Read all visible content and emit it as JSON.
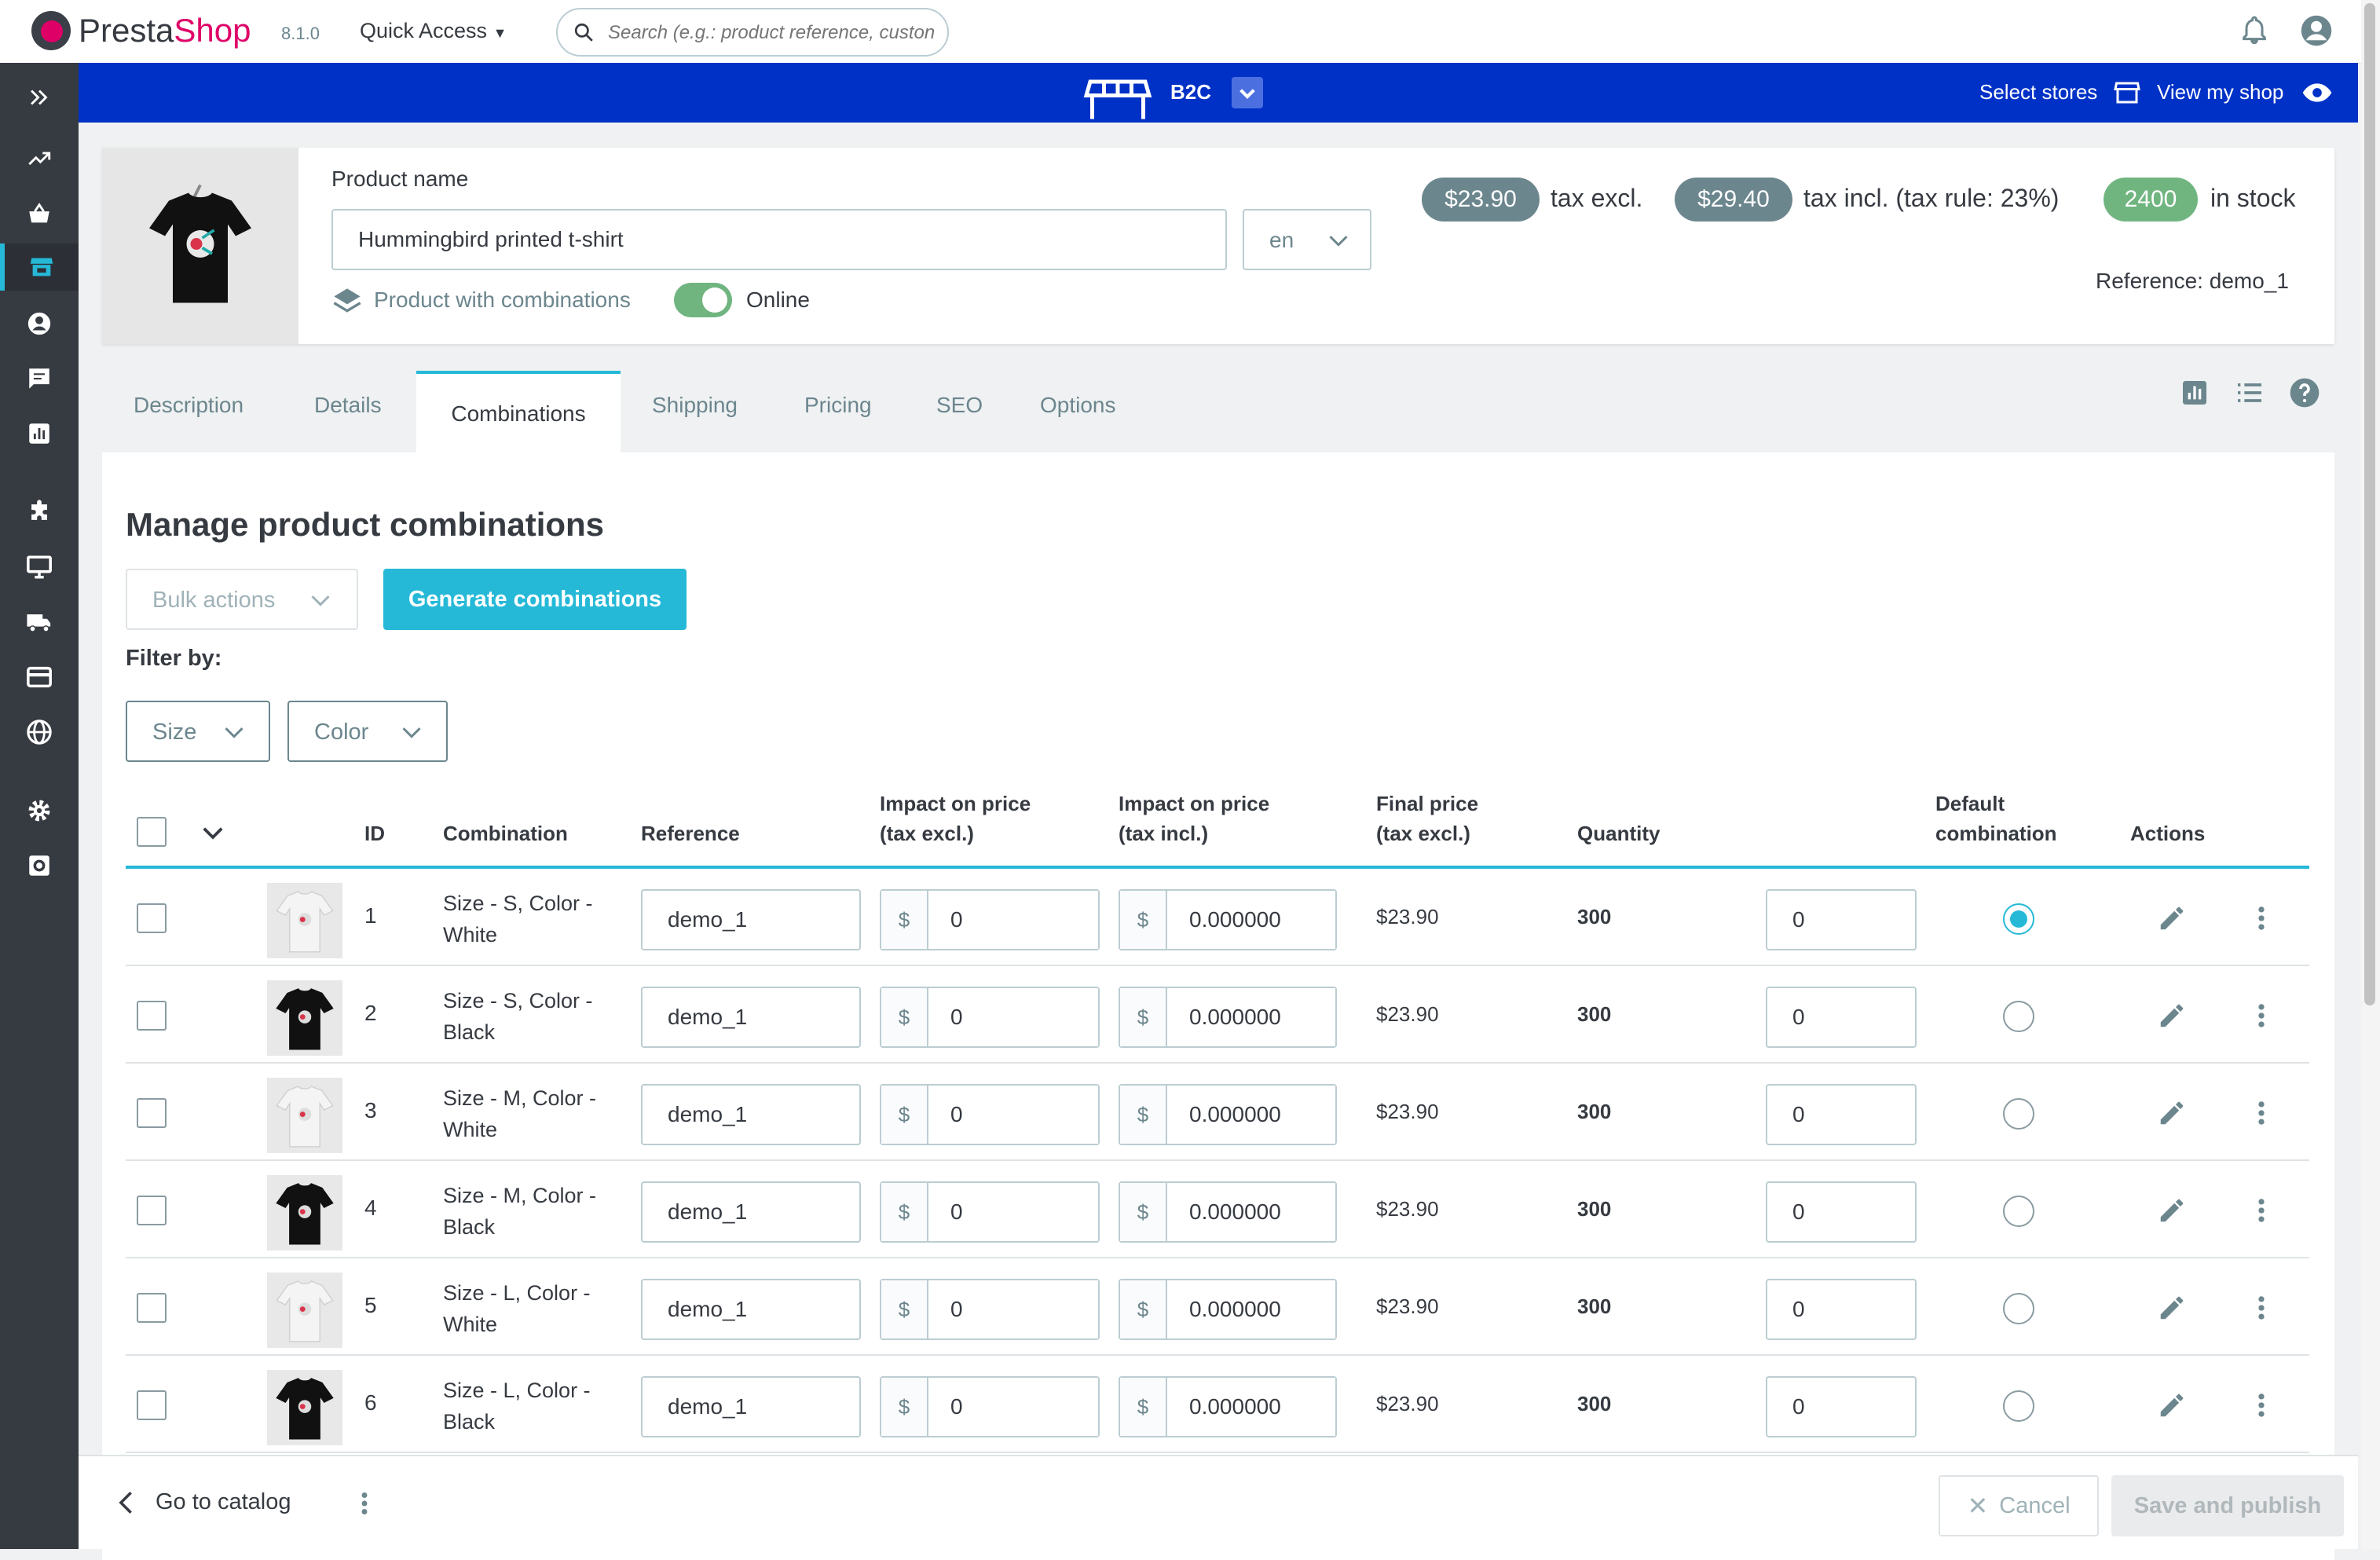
{
  "app": {
    "brand_part1": "Presta",
    "brand_part2": "Shop",
    "version": "8.1.0"
  },
  "header": {
    "quick_access": "Quick Access",
    "search_placeholder": "Search (e.g.: product reference, custon"
  },
  "storebar": {
    "store_name": "B2C",
    "select_stores": "Select stores",
    "view_shop": "View my shop",
    "color": "#0031c7"
  },
  "product": {
    "name_label": "Product name",
    "name_value": "Hummingbird printed t-shirt",
    "language": "en",
    "type_label": "Product with combinations",
    "online_label": "Online",
    "online": true,
    "price_excl": "$23.90",
    "price_excl_label": "tax excl.",
    "price_incl": "$29.40",
    "price_incl_label": "tax incl. (tax rule: 23%)",
    "stock": "2400",
    "stock_label": "in stock",
    "reference": "Reference: demo_1"
  },
  "tabs": [
    {
      "label": "Description"
    },
    {
      "label": "Details"
    },
    {
      "label": "Combinations",
      "active": true
    },
    {
      "label": "Shipping"
    },
    {
      "label": "Pricing"
    },
    {
      "label": "SEO"
    },
    {
      "label": "Options"
    }
  ],
  "combinations": {
    "title": "Manage product combinations",
    "bulk_actions": "Bulk actions",
    "generate": "Generate combinations",
    "filter_by": "Filter by:",
    "filters": [
      "Size",
      "Color"
    ],
    "columns": {
      "id": "ID",
      "combination": "Combination",
      "reference": "Reference",
      "impact_excl_1": "Impact on price",
      "impact_excl_2": "(tax excl.)",
      "impact_incl_1": "Impact on price",
      "impact_incl_2": "(tax incl.)",
      "final_1": "Final price",
      "final_2": "(tax excl.)",
      "quantity": "Quantity",
      "default_1": "Default",
      "default_2": "combination",
      "actions": "Actions"
    },
    "currency": "$",
    "rows": [
      {
        "id": "1",
        "name": "Size - S, Color - White",
        "shirt": "white",
        "reference": "demo_1",
        "impact_excl": "0",
        "impact_incl": "0.000000",
        "final": "$23.90",
        "quantity": "300",
        "delta": "0",
        "default": true
      },
      {
        "id": "2",
        "name": "Size - S, Color - Black",
        "shirt": "black",
        "reference": "demo_1",
        "impact_excl": "0",
        "impact_incl": "0.000000",
        "final": "$23.90",
        "quantity": "300",
        "delta": "0",
        "default": false
      },
      {
        "id": "3",
        "name": "Size - M, Color - White",
        "shirt": "white",
        "reference": "demo_1",
        "impact_excl": "0",
        "impact_incl": "0.000000",
        "final": "$23.90",
        "quantity": "300",
        "delta": "0",
        "default": false
      },
      {
        "id": "4",
        "name": "Size - M, Color - Black",
        "shirt": "black",
        "reference": "demo_1",
        "impact_excl": "0",
        "impact_incl": "0.000000",
        "final": "$23.90",
        "quantity": "300",
        "delta": "0",
        "default": false
      },
      {
        "id": "5",
        "name": "Size - L, Color - White",
        "shirt": "white",
        "reference": "demo_1",
        "impact_excl": "0",
        "impact_incl": "0.000000",
        "final": "$23.90",
        "quantity": "300",
        "delta": "0",
        "default": false
      },
      {
        "id": "6",
        "name": "Size - L, Color - Black",
        "shirt": "black",
        "reference": "demo_1",
        "impact_excl": "0",
        "impact_incl": "0.000000",
        "final": "$23.90",
        "quantity": "300",
        "delta": "0",
        "default": false
      }
    ]
  },
  "footer": {
    "go_to_catalog": "Go to catalog",
    "cancel": "Cancel",
    "save": "Save and publish"
  },
  "colors": {
    "accent": "#25b9d7",
    "success": "#70b580",
    "badge_dark": "#6c868e",
    "sidebar": "#363a41"
  }
}
